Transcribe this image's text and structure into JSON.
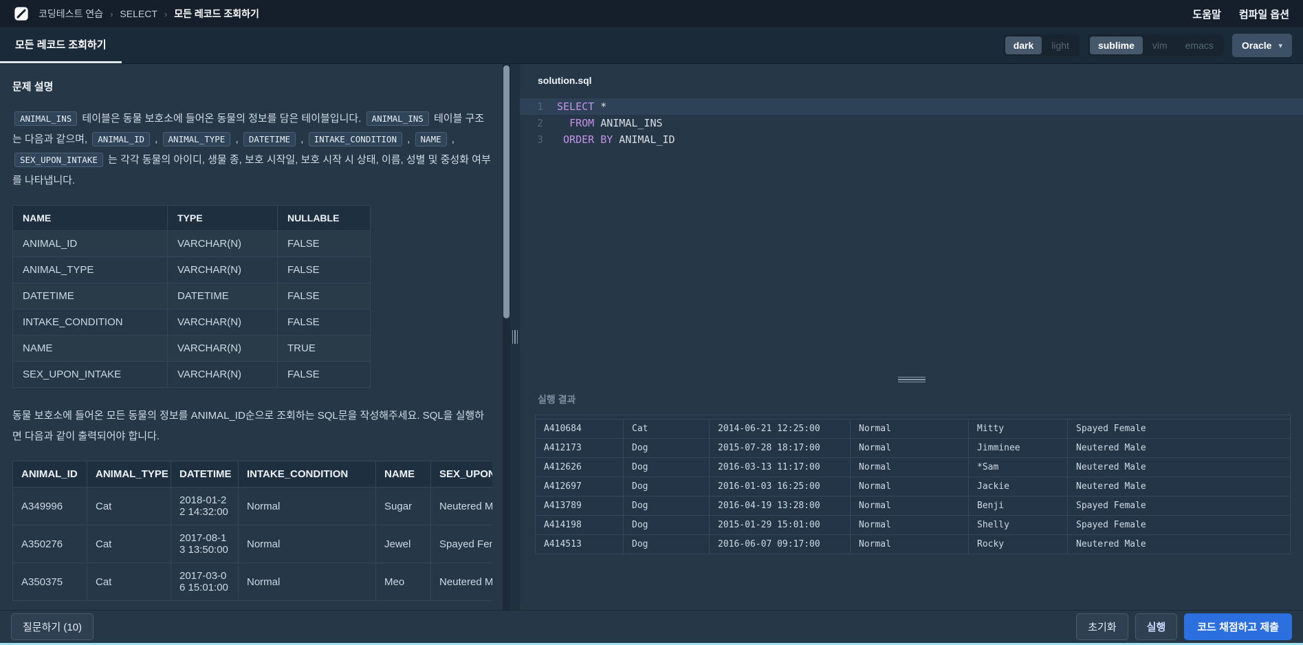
{
  "topbar": {
    "breadcrumb": [
      "코딩테스트 연습",
      "SELECT",
      "모든 레코드 조회하기"
    ],
    "help_label": "도움말",
    "compile_label": "컴파일 옵션"
  },
  "tabbar": {
    "tab_label": "모든 레코드 조회하기",
    "theme": {
      "options": [
        "dark",
        "light"
      ],
      "active": 0
    },
    "keymap": {
      "options": [
        "sublime",
        "vim",
        "emacs"
      ],
      "active": 0
    },
    "language_label": "Oracle",
    "language_caret": "▾"
  },
  "problem": {
    "title": "문제 설명",
    "intro": [
      [
        "c",
        "ANIMAL_INS"
      ],
      [
        "t",
        " 테이블은 동물 보호소에 들어온 동물의 정보를 담은 테이블입니다. "
      ],
      [
        "c",
        "ANIMAL_INS"
      ],
      [
        "t",
        " 테이블 구조는 다음과 같으며, "
      ],
      [
        "c",
        "ANIMAL_ID"
      ],
      [
        "t",
        " , "
      ],
      [
        "c",
        "ANIMAL_TYPE"
      ],
      [
        "t",
        " , "
      ],
      [
        "c",
        "DATETIME"
      ],
      [
        "t",
        " , "
      ],
      [
        "c",
        "INTAKE_CONDITION"
      ],
      [
        "t",
        " , "
      ],
      [
        "c",
        "NAME"
      ],
      [
        "t",
        " , "
      ],
      [
        "c",
        "SEX_UPON_INTAKE"
      ],
      [
        "t",
        " 는 각각 동물의 아이디, 생물 종, 보호 시작일, 보호 시작 시 상태, 이름, 성별 및 중성화 여부를 나타냅니다."
      ]
    ],
    "schema_table": {
      "headers": [
        "NAME",
        "TYPE",
        "NULLABLE"
      ],
      "rows": [
        [
          "ANIMAL_ID",
          "VARCHAR(N)",
          "FALSE"
        ],
        [
          "ANIMAL_TYPE",
          "VARCHAR(N)",
          "FALSE"
        ],
        [
          "DATETIME",
          "DATETIME",
          "FALSE"
        ],
        [
          "INTAKE_CONDITION",
          "VARCHAR(N)",
          "FALSE"
        ],
        [
          "NAME",
          "VARCHAR(N)",
          "TRUE"
        ],
        [
          "SEX_UPON_INTAKE",
          "VARCHAR(N)",
          "FALSE"
        ]
      ]
    },
    "task_text": "동물 보호소에 들어온 모든 동물의 정보를 ANIMAL_ID순으로 조회하는 SQL문을 작성해주세요. SQL을 실행하면 다음과 같이 출력되어야 합니다.",
    "example_table": {
      "headers": [
        "ANIMAL_ID",
        "ANIMAL_TYPE",
        "DATETIME",
        "INTAKE_CONDITION",
        "NAME",
        "SEX_UPON_INTAKE"
      ],
      "rows": [
        [
          "A349996",
          "Cat",
          "2018-01-22 14:32:00",
          "Normal",
          "Sugar",
          "Neutered Male"
        ],
        [
          "A350276",
          "Cat",
          "2017-08-13 13:50:00",
          "Normal",
          "Jewel",
          "Spayed Female"
        ],
        [
          "A350375",
          "Cat",
          "2017-03-06 15:01:00",
          "Normal",
          "Meo",
          "Neutered Male"
        ]
      ]
    }
  },
  "editor": {
    "filename": "solution.sql",
    "lines": [
      {
        "n": "1",
        "active": true,
        "t": [
          [
            "kw",
            "SELECT"
          ],
          [
            "pl",
            " *"
          ]
        ]
      },
      {
        "n": "2",
        "active": false,
        "t": [
          [
            "pl",
            "  "
          ],
          [
            "kw",
            "FROM"
          ],
          [
            "pl",
            " ANIMAL_INS"
          ]
        ]
      },
      {
        "n": "3",
        "active": false,
        "t": [
          [
            "pl",
            " "
          ],
          [
            "kw",
            "ORDER"
          ],
          [
            "pl",
            " "
          ],
          [
            "kw",
            "BY"
          ],
          [
            "pl",
            " ANIMAL_ID"
          ]
        ]
      }
    ]
  },
  "results": {
    "title": "실행 결과",
    "rows": [
      [
        "A410684",
        "Cat",
        "2014-06-21 12:25:00",
        "Normal",
        "Mitty",
        "Spayed Female"
      ],
      [
        "A412173",
        "Dog",
        "2015-07-28 18:17:00",
        "Normal",
        "Jimminee",
        "Neutered Male"
      ],
      [
        "A412626",
        "Dog",
        "2016-03-13 11:17:00",
        "Normal",
        "*Sam",
        "Neutered Male"
      ],
      [
        "A412697",
        "Dog",
        "2016-01-03 16:25:00",
        "Normal",
        "Jackie",
        "Neutered Male"
      ],
      [
        "A413789",
        "Dog",
        "2016-04-19 13:28:00",
        "Normal",
        "Benji",
        "Spayed Female"
      ],
      [
        "A414198",
        "Dog",
        "2015-01-29 15:01:00",
        "Normal",
        "Shelly",
        "Spayed Female"
      ],
      [
        "A414513",
        "Dog",
        "2016-06-07 09:17:00",
        "Normal",
        "Rocky",
        "Neutered Male"
      ]
    ]
  },
  "footer": {
    "ask_label": "질문하기 (10)",
    "reset_label": "초기화",
    "run_label": "실행",
    "submit_label": "코드 채점하고 제출"
  },
  "colors": {
    "panel_bg": "#263747",
    "topbar_bg": "#141f2b",
    "accent_blue": "#2c6fdf",
    "keyword_purple": "#c792ea",
    "bottom_strip": "#9fe0f2"
  }
}
